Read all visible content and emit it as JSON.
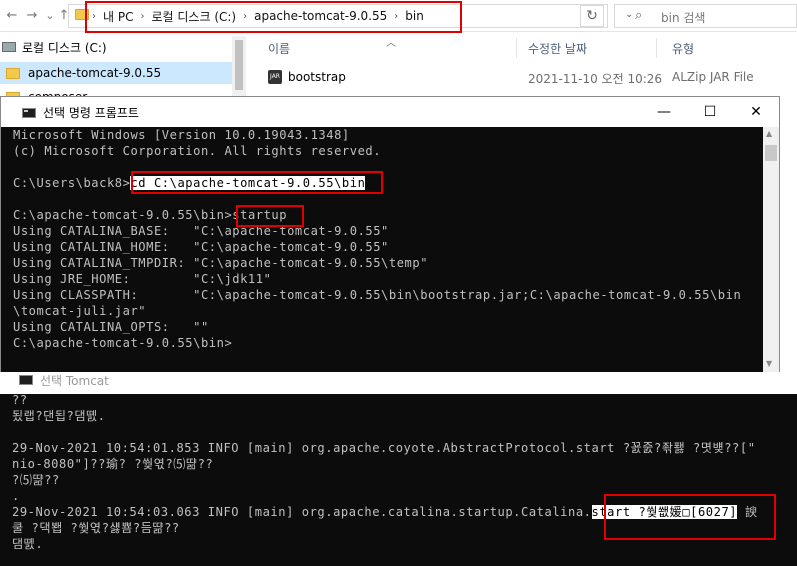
{
  "explorer": {
    "nav_back": "←",
    "nav_forward": "→",
    "nav_history": "⌄",
    "nav_up": "↑",
    "breadcrumbs": [
      "내 PC",
      "로컬 디스크 (C:)",
      "apache-tomcat-9.0.55",
      "bin"
    ],
    "breadcrumb_sep": "›",
    "refresh_icon": "↻",
    "search_placeholder": "bin 검색",
    "search_icon": "⌕",
    "nav_items": [
      "로컬 디스크 (C:)",
      "apache-tomcat-9.0.55",
      "composer"
    ],
    "columns": {
      "name": "이름",
      "modified": "수정한 날짜",
      "type": "유형"
    },
    "files": [
      {
        "name": "bootstrap",
        "modified": "2021-11-10 오전 10:26",
        "type": "ALZip JAR File"
      }
    ],
    "jar_icon": "JAR"
  },
  "cmd": {
    "title": "선택 명령 프롬프트",
    "minimize": "—",
    "maximize": "☐",
    "close": "✕",
    "lines": [
      "Microsoft Windows [Version 10.0.19043.1348]",
      "(c) Microsoft Corporation. All rights reserved.",
      "",
      "C:\\Users\\back8>",
      "",
      "C:\\apache-tomcat-9.0.55\\bin>",
      "Using CATALINA_BASE:   \"C:\\apache-tomcat-9.0.55\"",
      "Using CATALINA_HOME:   \"C:\\apache-tomcat-9.0.55\"",
      "Using CATALINA_TMPDIR: \"C:\\apache-tomcat-9.0.55\\temp\"",
      "Using JRE_HOME:        \"C:\\jdk11\"",
      "Using CLASSPATH:       \"C:\\apache-tomcat-9.0.55\\bin\\bootstrap.jar;C:\\apache-tomcat-9.0.55\\bin",
      "\\tomcat-juli.jar\"",
      "Using CATALINA_OPTS:   \"\"",
      "C:\\apache-tomcat-9.0.55\\bin>"
    ],
    "cd_command": "cd C:\\apache-tomcat-9.0.55\\bin",
    "startup_command": "startup"
  },
  "tomcat": {
    "title": "선택 Tomcat",
    "lines": [
      "??",
      "됬랩?댄됩?댐똀.",
      "",
      "29-Nov-2021 10:54:01.853 INFO [main] org.apache.coyote.AbstractProtocol.start ?꾨줈?좎퐳 ?몃뱾??[\"",
      "nio-8080\"]??瑜? ?쒖엯?⑸땲??",
      "?⑸땲??",
      ".",
      "29-Nov-2021 10:54:03.063 INFO [main] org.apache.catalina.startup.Catalina.",
      "쿨 ?댁봽 ?쒖엯?섏뿀?듬땲??",
      "댐똀."
    ],
    "line8_highlight": "start ?쒖쐢媛□[6027]",
    "line8_tail": " 諛"
  }
}
